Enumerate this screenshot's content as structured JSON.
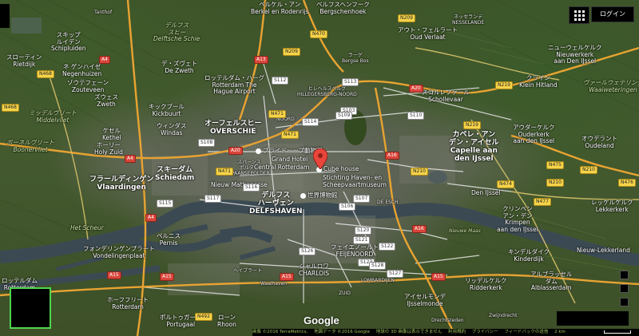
{
  "controls": {
    "login_label": "ログイン",
    "grid_icon": "apps-grid-icon"
  },
  "places": [
    {
      "id": "tanthof",
      "text": "Tanthof"
    },
    {
      "id": "schipluiden",
      "text": "スキップ\nルイデン\nSchipluiden"
    },
    {
      "id": "rietdijk",
      "text": "スローティン\nRietdijk"
    },
    {
      "id": "negenhuizen",
      "text": "ネ ゲンハイゼ\nNegenhuizen"
    },
    {
      "id": "zouteveen",
      "text": "ゾウテフェーン\nZouteveen"
    },
    {
      "id": "zweth",
      "text": "ズウェス\nZweth"
    },
    {
      "id": "middelvliet",
      "text": "ミッデルヴリート\nMiddelvliet"
    },
    {
      "id": "boonervliet",
      "text": "ボーネルヴリート\nBoonervliet"
    },
    {
      "id": "kethel",
      "text": "ケセル\nKethel"
    },
    {
      "id": "holy_zuid",
      "text": "ホーリー\nHoly Zuid"
    },
    {
      "id": "vlaardingen",
      "text": "フラールディンゲン\nVlaardingen"
    },
    {
      "id": "het_scheur",
      "text": "Het Scheur"
    },
    {
      "id": "vondelingenplaat",
      "text": "フォンデリンゲンプラート\nVondelingenplaat"
    },
    {
      "id": "rotterdam_w",
      "text": "ロッテルダム\nRotterdam"
    },
    {
      "id": "hoogvliet",
      "text": "ホーフフリート\nRotterdam"
    },
    {
      "id": "portugaal",
      "text": "ポルトゥガール\nPortugaal"
    },
    {
      "id": "rhoon",
      "text": "ローン\nRhoon"
    },
    {
      "id": "delftsche_schie",
      "text": "デルフス\nスヒー\nDelftsche Schie"
    },
    {
      "id": "de_zweth",
      "text": "デ・ズヴェト\nDe Zweth"
    },
    {
      "id": "airport",
      "text": "ロッテルダム・ハーグ\nRotterdam The\nHague Airport"
    },
    {
      "id": "kickbuurt",
      "text": "キックブール\nKickbuurt"
    },
    {
      "id": "windas",
      "text": "ウィンダス\nWindas"
    },
    {
      "id": "overschie",
      "text": "オーフェルスヒー\nOVERSCHIE"
    },
    {
      "id": "schiedam",
      "text": "スキーダム\nSchiedam"
    },
    {
      "id": "nieuw_mathenesse",
      "text": "Nieuw Mathenesse"
    },
    {
      "id": "spaanse",
      "text": "スパーンス\nポルダー\nSPAANSEPOLDER"
    },
    {
      "id": "delfshaven",
      "text": "デルフス\nハーヴェン\nDELFSHAVEN"
    },
    {
      "id": "pernis",
      "text": "ペルニス\nPernis"
    },
    {
      "id": "hillegersberg",
      "text": "ヒレヘルスベルグ\nHILLEGERSBERG-NOORD"
    },
    {
      "id": "noord",
      "text": "NOORD"
    },
    {
      "id": "berkel",
      "text": "ベルケル・アン\nBerkel en Rodenrijs"
    },
    {
      "id": "bergschenhoek",
      "text": "ベルフスヘンフーク\nBergschenhoek"
    },
    {
      "id": "oud_verlaat",
      "text": "アウト・フェルラート\nOud Verlaat"
    },
    {
      "id": "bergse_bos",
      "text": "ラーゲ\nBergse Bos"
    },
    {
      "id": "nesselande",
      "text": "ネッセランデ\nNESSELANDE"
    },
    {
      "id": "nieuwerkerk",
      "text": "ニューウェルケルク\nNieuwerkerk\naan Den IJssel"
    },
    {
      "id": "klein_hitland",
      "text": "クライン\nKlein Hitland"
    },
    {
      "id": "waalweteringen",
      "text": "ヴァールウェテリング\nWaaiweteringen"
    },
    {
      "id": "schollevaar",
      "text": "スコルレファール\nSchollevaar"
    },
    {
      "id": "capelle",
      "text": "カペレ・アン\nデン・アイセル\nCapelle aan\nden IJssel"
    },
    {
      "id": "ouderkerk",
      "text": "アウダーケルク\nOuderkerk\naan den IJssel"
    },
    {
      "id": "oudeland",
      "text": "オウデラント\nOudeland"
    },
    {
      "id": "den_ijssel",
      "text": "Den IJssel"
    },
    {
      "id": "krimpen",
      "text": "クリンペン\nアン・デン\nKrimpen\naan den IJssel"
    },
    {
      "id": "lekkerkerk",
      "text": "レッケルケルク\nLekkerkerk"
    },
    {
      "id": "nieuw_lekkerland",
      "text": "Nieuw-Lekkerland"
    },
    {
      "id": "kinderdijk",
      "text": "キンデルダイク\nKinderdijk"
    },
    {
      "id": "alblasserdam",
      "text": "アルブラッセル\nダム\nAlblasserdam"
    },
    {
      "id": "ridderkerk",
      "text": "リッデルケルク\nRidderkerk"
    },
    {
      "id": "zwijndrecht",
      "text": "Zwijndrecht"
    },
    {
      "id": "de_esch",
      "text": "DE ESCH"
    },
    {
      "id": "nieuwe_maas",
      "text": "Nieuwe Maas"
    },
    {
      "id": "feijenoord",
      "text": "フェイエノールト\nFEIJENOORD"
    },
    {
      "id": "lombardijen",
      "text": "LOMBARDIJEN"
    },
    {
      "id": "charlois",
      "text": "シャルロワ\nCHARLOIS"
    },
    {
      "id": "zuid",
      "text": "ZUID"
    },
    {
      "id": "heijplaat",
      "text": "ヘイプラート"
    },
    {
      "id": "waalhaven",
      "text": "Waalhaven"
    },
    {
      "id": "ijsselmonde",
      "text": "アイセルモンデ\nIJsselmonde"
    },
    {
      "id": "drechtsteden",
      "text": "Drechtsteden"
    }
  ],
  "pois": [
    {
      "id": "blijdorp",
      "text": "ブライドーープ動物園"
    },
    {
      "id": "grand_hotel",
      "text": "Grand Hotel"
    },
    {
      "id": "central_station",
      "text": "Central Rotterdam"
    },
    {
      "id": "cube_house",
      "text": "Cube house"
    },
    {
      "id": "maritime",
      "text": "Stichting Haven- en\nScheepvaartmuseum"
    },
    {
      "id": "world_museum",
      "text": "世界博物館"
    }
  ],
  "roads": [
    "A4",
    "A4",
    "A20",
    "A20",
    "A13",
    "A16",
    "A16",
    "A15",
    "A15",
    "A15",
    "A15",
    "A4",
    "N468",
    "N468",
    "N470",
    "N209",
    "N209",
    "N471",
    "N471",
    "N471",
    "N219",
    "N219",
    "N210",
    "N210",
    "N210",
    "N475",
    "N474",
    "N477",
    "N476",
    "N492",
    "S112",
    "S113",
    "S114",
    "S103",
    "S106",
    "S107",
    "S108",
    "S109",
    "S110",
    "S115",
    "S116",
    "S117",
    "S120",
    "S121",
    "S122",
    "S123",
    "S126",
    "S127",
    "S128"
  ],
  "footer": {
    "imagery": "画像 ©2016 TerraMetrics,",
    "map_data": "地図データ ©2016 Google",
    "notice": "地球の 3D 画像は表示できません",
    "terms": "利用規約",
    "privacy": "プライバシー",
    "feedback": "フィードバックの送信",
    "scale": "2 km"
  },
  "logo": "Google",
  "colors": {
    "road_major": "#e8a332",
    "road_minor": "#f1f1f1",
    "water": "#3f4f57",
    "pin": "#e8463b",
    "accent_green": "#4ed64e"
  }
}
